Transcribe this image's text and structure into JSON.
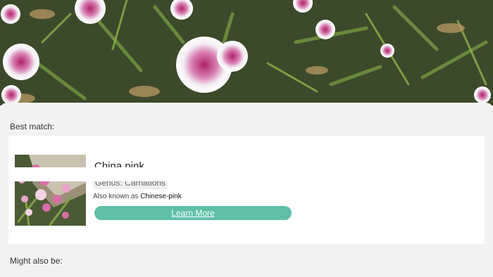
{
  "hero": {
    "image": "dianthus-flowers-photo"
  },
  "best_match": {
    "section_label": "Best match:",
    "name": "China pink",
    "genus": "Genus: Carnations",
    "aka_prefix": "Also known as ",
    "aka_value": "Chinese-pink",
    "button_label": "Learn More",
    "accent_color": "#5ebfa6"
  },
  "might_also_be": {
    "section_label": "Might also be:"
  }
}
